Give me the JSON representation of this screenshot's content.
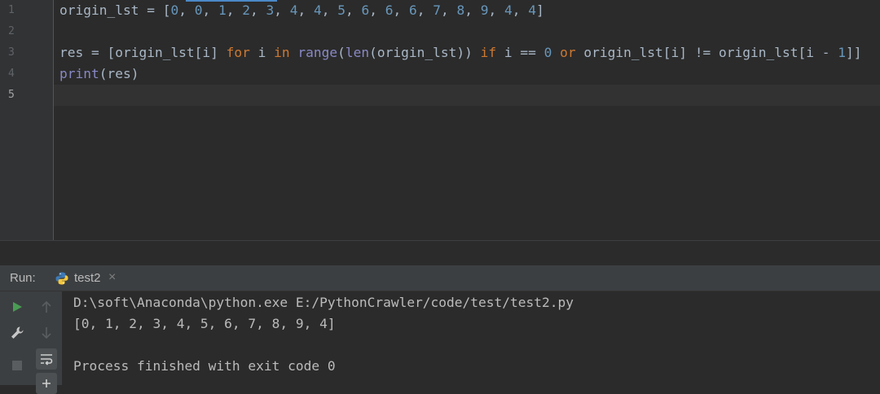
{
  "editor": {
    "line_numbers": [
      "1",
      "2",
      "3",
      "4",
      "5"
    ],
    "active_line": "5",
    "code": {
      "line1": {
        "var": "origin_lst = ",
        "open": "[",
        "items": [
          "0",
          "0",
          "1",
          "2",
          "3",
          "4",
          "4",
          "5",
          "6",
          "6",
          "6",
          "7",
          "8",
          "9",
          "4",
          "4"
        ],
        "sep": ", ",
        "close": "]"
      },
      "line3": {
        "p1": "res = [origin_lst[i] ",
        "kw_for": "for",
        "p2": " i ",
        "kw_in": "in",
        "p3": " ",
        "fn_range": "range",
        "p4": "(",
        "fn_len": "len",
        "p5": "(origin_lst)) ",
        "kw_if": "if",
        "p6": " i == ",
        "num0": "0",
        "p7": " ",
        "kw_or": "or",
        "p8": " origin_lst[i] != origin_lst[i - ",
        "num1": "1",
        "p9": "]]"
      },
      "line4": {
        "fn_print": "print",
        "rest": "(res)"
      }
    }
  },
  "run_panel": {
    "label": "Run:",
    "tab_label": "test2",
    "close_glyph": "×"
  },
  "console": {
    "lines": [
      "D:\\soft\\Anaconda\\python.exe E:/PythonCrawler/code/test/test2.py",
      "[0, 1, 2, 3, 4, 5, 6, 7, 8, 9, 4]",
      "",
      "Process finished with exit code 0"
    ]
  },
  "icons": {
    "run": "play-icon",
    "up": "arrow-up-icon",
    "wrench": "wrench-icon",
    "down": "arrow-down-icon",
    "stop": "stop-icon",
    "wrap": "soft-wrap-icon",
    "pin": "pin-icon"
  },
  "colors": {
    "keyword": "#cc7832",
    "number": "#6897bb",
    "builtin": "#8888c6",
    "text": "#a9b7c6",
    "run_green": "#499c54"
  }
}
